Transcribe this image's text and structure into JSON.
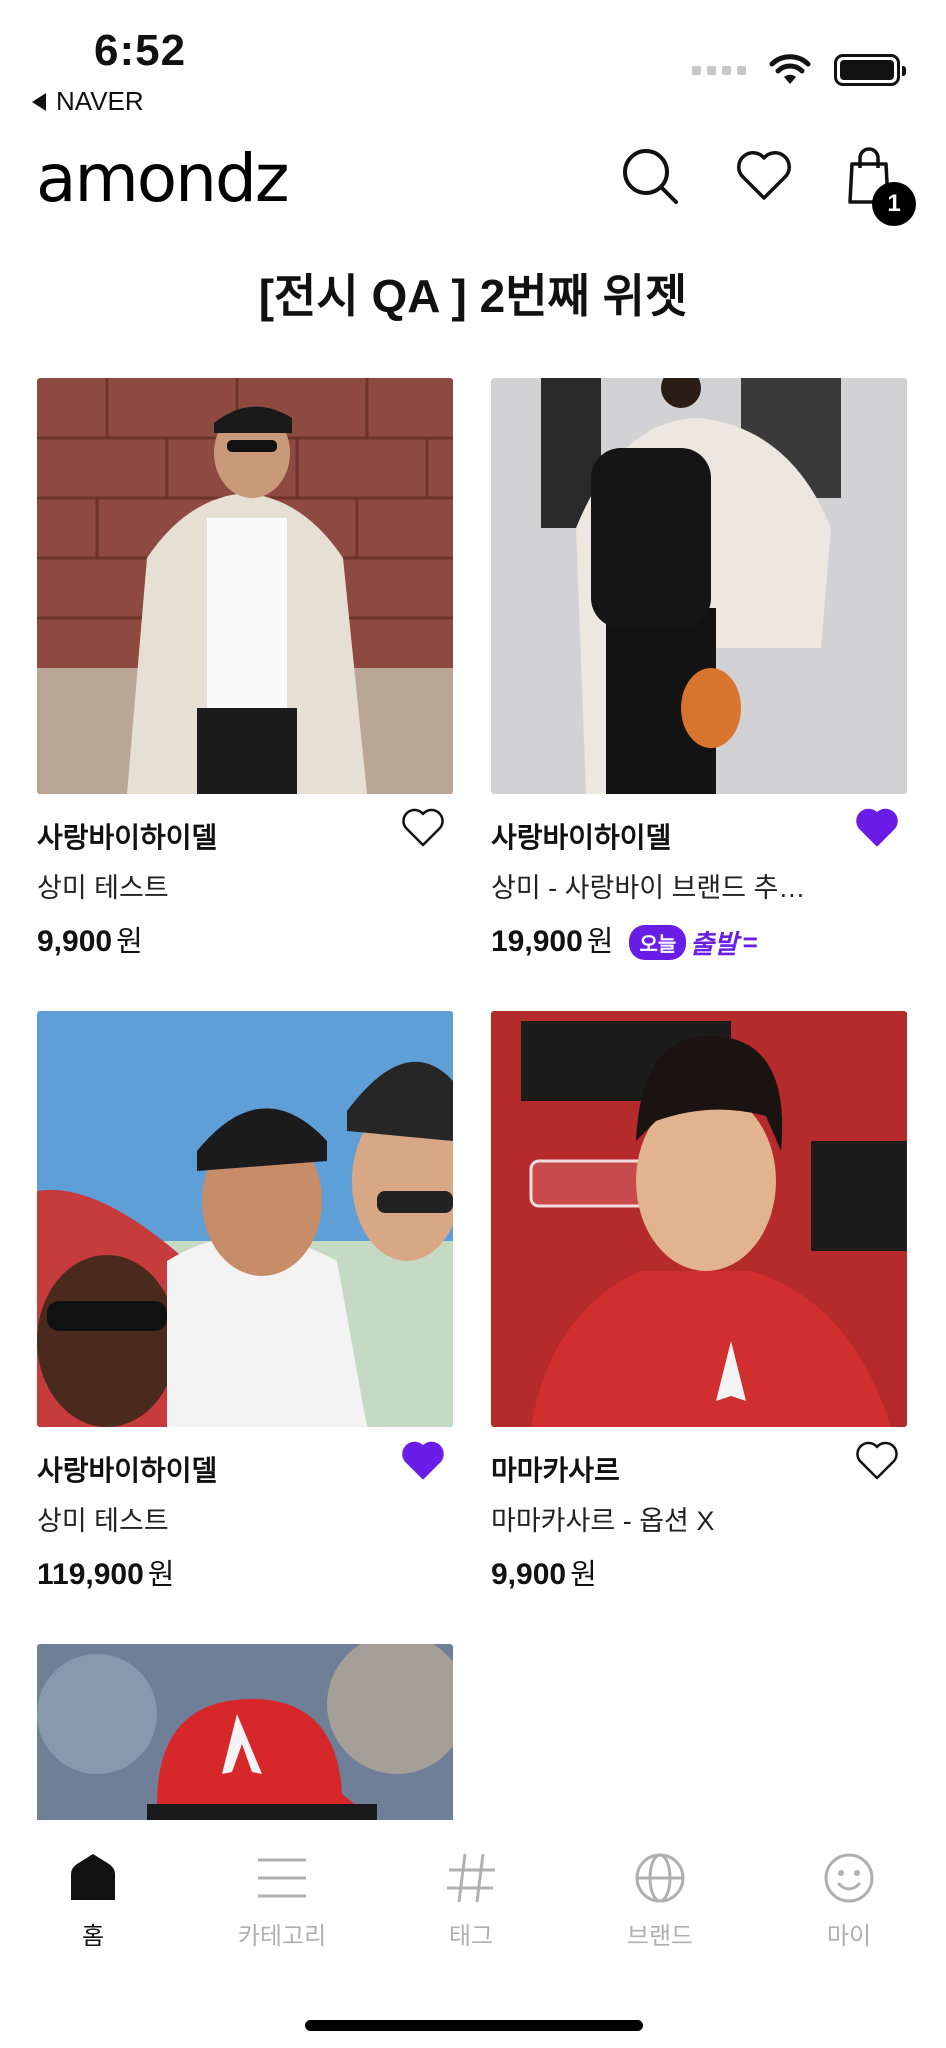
{
  "status_bar": {
    "time": "6:52",
    "back_app": "NAVER"
  },
  "header": {
    "logo": "amondz",
    "cart_count": "1"
  },
  "section_title": "[전시 QA ] 2번째 위젯",
  "products": [
    {
      "brand": "사랑바이하이델",
      "name": "상미 테스트",
      "price": "9,900",
      "currency": "원",
      "liked": false
    },
    {
      "brand": "사랑바이하이델",
      "name": "상미 - 사랑바이 브랜드 추…",
      "price": "19,900",
      "currency": "원",
      "liked": true,
      "badge_pill": "오늘",
      "badge_text": "출발",
      "badge_tail": "="
    },
    {
      "brand": "사랑바이하이델",
      "name": "상미 테스트",
      "price": "119,900",
      "currency": "원",
      "liked": true
    },
    {
      "brand": "마마카사르",
      "name": "마마카사르 - 옵션 X",
      "price": "9,900",
      "currency": "원",
      "liked": false
    }
  ],
  "nav": [
    {
      "label": "홈",
      "icon": "home-icon",
      "active": true
    },
    {
      "label": "카테고리",
      "icon": "menu-icon",
      "active": false
    },
    {
      "label": "태그",
      "icon": "hashtag-icon",
      "active": false
    },
    {
      "label": "브랜드",
      "icon": "globe-icon",
      "active": false
    },
    {
      "label": "마이",
      "icon": "smiley-icon",
      "active": false
    }
  ],
  "colors": {
    "accent": "#6a1de6",
    "text": "#111111",
    "nav_inactive": "#b0b0b0"
  }
}
